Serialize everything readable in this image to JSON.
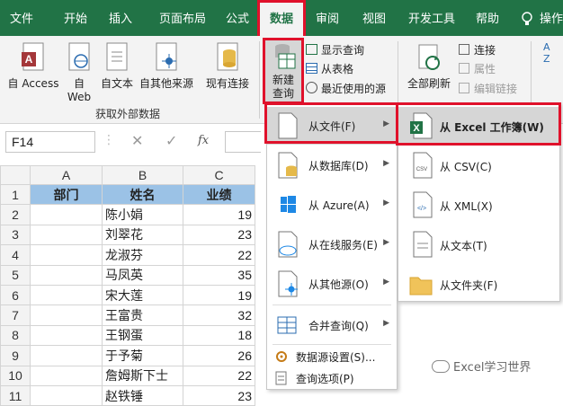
{
  "tabs": [
    "文件",
    "开始",
    "插入",
    "页面布局",
    "公式",
    "数据",
    "审阅",
    "视图",
    "开发工具",
    "帮助",
    "操作"
  ],
  "ribbon": {
    "access": "自 Access",
    "web_line1": "自",
    "web_line2": "Web",
    "text": "自文本",
    "other": "自其他来源",
    "existing": "现有连接",
    "group_external": "获取外部数据",
    "new_query_line1": "新建",
    "new_query_line2": "查询",
    "show_query": "显示查询",
    "from_table": "从表格",
    "recent_sources": "最近使用的源",
    "refresh_all": "全部刷新",
    "connections": "连接",
    "properties": "属性",
    "edit_links": "编辑链接",
    "sort_az": "A Z"
  },
  "formula_bar": {
    "name_box": "F14",
    "fx": "fx"
  },
  "columns": [
    "A",
    "B",
    "C"
  ],
  "header_row": {
    "row": "1",
    "a": "部门",
    "b": "姓名",
    "c": "业绩"
  },
  "rows": [
    {
      "row": "2",
      "b": "陈小娟",
      "c": "19"
    },
    {
      "row": "3",
      "b": "刘翠花",
      "c": "23"
    },
    {
      "row": "4",
      "b": "龙淑芬",
      "c": "22"
    },
    {
      "row": "5",
      "b": "马凤英",
      "c": "35"
    },
    {
      "row": "6",
      "b": "宋大莲",
      "c": "19"
    },
    {
      "row": "7",
      "b": "王富贵",
      "c": "32"
    },
    {
      "row": "8",
      "b": "王钢蛋",
      "c": "18"
    },
    {
      "row": "9",
      "b": "于予菊",
      "c": "26"
    },
    {
      "row": "10",
      "b": "詹姆斯下士",
      "c": "22"
    },
    {
      "row": "11",
      "b": "赵铁锤",
      "c": "23"
    }
  ],
  "menu": {
    "from_file": "从文件(F)",
    "from_database": "从数据库(D)",
    "from_azure": "从 Azure(A)",
    "from_online": "从在线服务(E)",
    "from_other": "从其他源(O)",
    "merge_query": "合并查询(Q)",
    "source_settings": "数据源设置(S)...",
    "query_options": "查询选项(P)"
  },
  "submenu": {
    "excel_workbook": "从 Excel 工作簿(W)",
    "csv": "从 CSV(C)",
    "xml": "从 XML(X)",
    "text": "从文本(T)",
    "folder": "从文件夹(F)"
  },
  "watermark": "Excel学习世界",
  "colors": {
    "excel_green": "#217346",
    "header_fill": "#9bc2e6",
    "highlight_red": "#e0112b"
  }
}
